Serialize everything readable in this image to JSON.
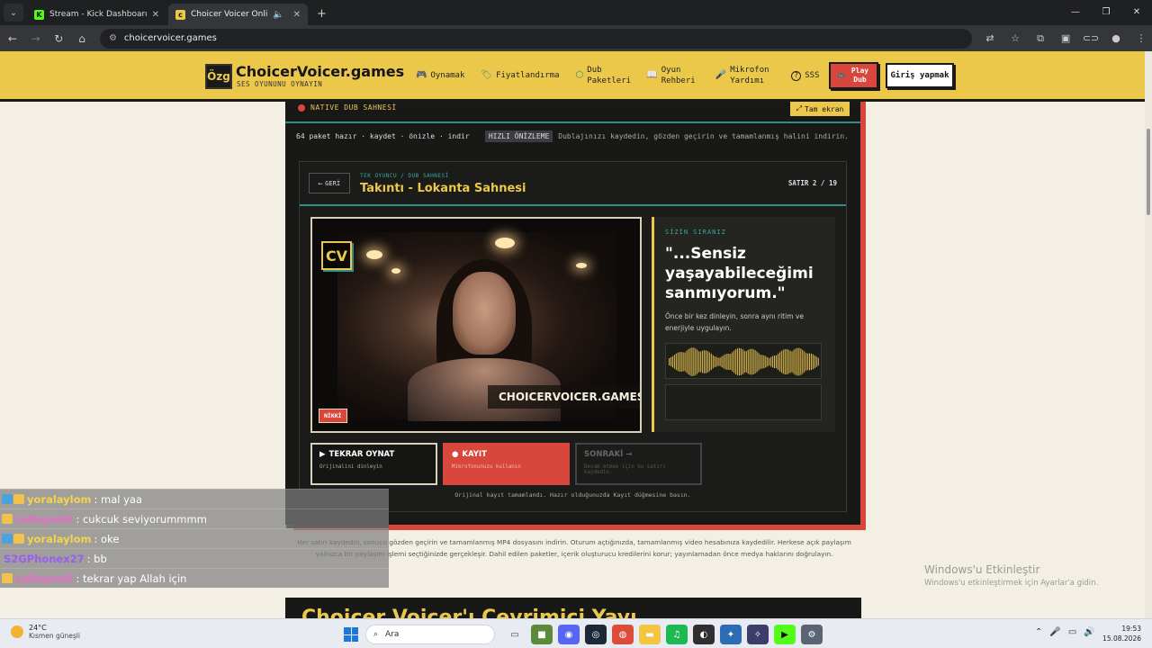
{
  "browser": {
    "tabs": [
      {
        "title": "Stream - Kick Dashboard",
        "favicon": "kick-icon",
        "color": "#53fc18",
        "active": false
      },
      {
        "title": "Choicer Voicer Online Ücret",
        "favicon": "cv-icon",
        "color": "#ecc84a",
        "active": true
      }
    ],
    "url": "choicervoicer.games"
  },
  "site": {
    "logo_text": "Özg",
    "brand": "ChoicerVoicer.games",
    "tagline": "SES OYUNUNU OYNAYIN",
    "menu": [
      {
        "icon": "gamepad-icon",
        "glyph": "🎮",
        "label": "Oynamak"
      },
      {
        "icon": "tag-icon",
        "glyph": "🏷",
        "label": "Fiyatlandırma"
      },
      {
        "icon": "package-icon",
        "glyph": "⬡",
        "label": "Dub Paketleri"
      },
      {
        "icon": "book-icon",
        "glyph": "📖",
        "label": "Oyun Rehberi"
      },
      {
        "icon": "mic-icon",
        "glyph": "🎤",
        "label": "Mikrofon Yardımı"
      },
      {
        "icon": "help-icon",
        "glyph": "?",
        "label": "SSS"
      }
    ],
    "play_button": "Play Dub",
    "login_button": "Giriş yapmak"
  },
  "panel": {
    "section_label": "NATIVE DUB SAHNESİ",
    "fullscreen": "Tam ekran",
    "info_left": "64 paket hazır · kaydet · önizle · indir",
    "quick_badge": "HIZLI ÖNİZLEME",
    "quick_text": "Dublajınızı kaydedin, gözden geçirin ve tamamlanmış halini indirin.",
    "back": "GERİ",
    "breadcrumb": "TEK OYUNCU / DUB SAHNESİ",
    "scene_title": "Takıntı - Lokanta Sahnesi",
    "line_counter": "SATIR 2 / 19",
    "video": {
      "badge": "CV",
      "watermark": "CHOICERVOICER.GAMES",
      "character": "NİKKİ"
    },
    "cue": {
      "label": "SİZİN SIRANIZ",
      "line": "\"...Sensiz yaşayabileceğimi sanmıyorum.\"",
      "help": "Önce bir kez dinleyin, sonra aynı ritim ve enerjiyle uygulayın."
    },
    "actions": [
      {
        "title": "TEKRAR OYNAT",
        "sub": "Orijinalini dinleyin",
        "icon": "▶"
      },
      {
        "title": "KAYIT",
        "sub": "Mikrofonunuzu kullanın",
        "icon": "●"
      },
      {
        "title": "SONRAKİ →",
        "sub": "Devam etmek için bu satırı kaydedin.",
        "icon": ""
      }
    ],
    "status": "Orijinal kayıt tamamlandı. Hazır olduğunuzda Kayıt düğmesine basın."
  },
  "below_text": "Her satırı kaydedin, sonucu gözden geçirin ve tamamlanmış MP4 dosyasını indirin. Oturum açtığınızda, tamamlanmış video hesabınıza kaydedilir. Herkese açık paylaşım yalnızca bir paylaşım işlemi seçtiğinizde gerçekleşir. Dahil edilen paketler, içerik oluşturucu kredilerini korur; yayınlamadan önce medya haklarını doğrulayın.",
  "bottom_heading": "Choicer Voicer'ı Çevrimiçi Yayı",
  "windows_activate": {
    "title": "Windows'u Etkinleştir",
    "sub": "Windows'u etkinleştirmek için Ayarlar'a gidin."
  },
  "chat": [
    {
      "user": "yoralaylom",
      "msg": ": mal yaa",
      "color": "#f4d44a"
    },
    {
      "user": "Lallaysolii",
      "msg": ": cukcuk seviyorummmm",
      "color": "#e96cc8"
    },
    {
      "user": "yoralaylom",
      "msg": ": oke",
      "color": "#f4d44a"
    },
    {
      "user": "S2GPhonex27",
      "msg": ": bb",
      "color": "#9b5cf6"
    },
    {
      "user": "Lallaysolii",
      "msg": ": tekrar yap Allah için",
      "color": "#e96cc8"
    }
  ],
  "taskbar": {
    "temp": "24°C",
    "weather": "Kısmen güneşli",
    "search": "Ara",
    "time": "19:53",
    "date": "15.08.2026"
  }
}
